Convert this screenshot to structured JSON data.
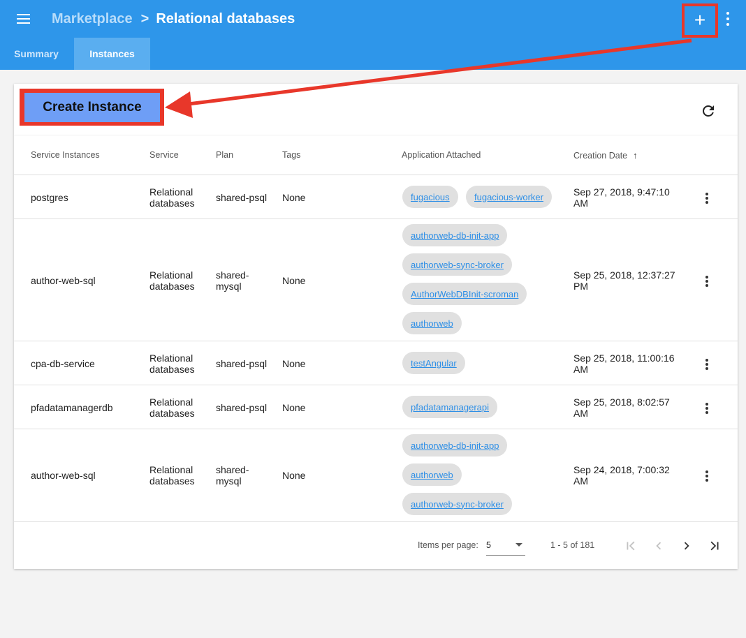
{
  "header": {
    "breadcrumb_parent": "Marketplace",
    "breadcrumb_separator": ">",
    "breadcrumb_current": "Relational databases",
    "add_icon_glyph": "+",
    "icons": [
      "menu-icon",
      "plus-icon",
      "more-vert-icon"
    ]
  },
  "tabs": [
    {
      "label": "Summary",
      "active": false
    },
    {
      "label": "Instances",
      "active": true
    }
  ],
  "toolbar": {
    "create_label": "Create Instance",
    "refresh_icon": "refresh-icon"
  },
  "table": {
    "columns": [
      "Service Instances",
      "Service",
      "Plan",
      "Tags",
      "Application Attached",
      "Creation Date"
    ],
    "sort_icon": "arrow-up-icon",
    "rows": [
      {
        "name": "postgres",
        "service": "Relational databases",
        "plan": "shared-psql",
        "tags": "None",
        "apps": [
          "fugacious",
          "fugacious-worker"
        ],
        "date": "Sep 27, 2018, 9:47:10 AM"
      },
      {
        "name": "author-web-sql",
        "service": "Relational databases",
        "plan": "shared-mysql",
        "tags": "None",
        "apps": [
          "authorweb-db-init-app",
          "authorweb-sync-broker",
          "AuthorWebDBInit-scroman",
          "authorweb"
        ],
        "date": "Sep 25, 2018, 12:37:27 PM"
      },
      {
        "name": "cpa-db-service",
        "service": "Relational databases",
        "plan": "shared-psql",
        "tags": "None",
        "apps": [
          "testAngular"
        ],
        "date": "Sep 25, 2018, 11:00:16 AM"
      },
      {
        "name": "pfadatamanagerdb",
        "service": "Relational databases",
        "plan": "shared-psql",
        "tags": "None",
        "apps": [
          "pfadatamanagerapi"
        ],
        "date": "Sep 25, 2018, 8:02:57 AM"
      },
      {
        "name": "author-web-sql",
        "service": "Relational databases",
        "plan": "shared-mysql",
        "tags": "None",
        "apps": [
          "authorweb-db-init-app",
          "authorweb",
          "authorweb-sync-broker"
        ],
        "date": "Sep 24, 2018, 7:00:32 AM"
      }
    ]
  },
  "paginator": {
    "items_per_page_label": "Items per page:",
    "page_size": "5",
    "range": "1 - 5 of 181",
    "icons": [
      "first-page-icon",
      "chevron-left-icon",
      "chevron-right-icon",
      "last-page-icon"
    ]
  },
  "colors": {
    "appbar": "#2e96ea",
    "active_tab": "#5aaef0",
    "create_button": "#6e9ef6",
    "annotation": "#e8372a",
    "chip_link": "#2e8fe6"
  }
}
